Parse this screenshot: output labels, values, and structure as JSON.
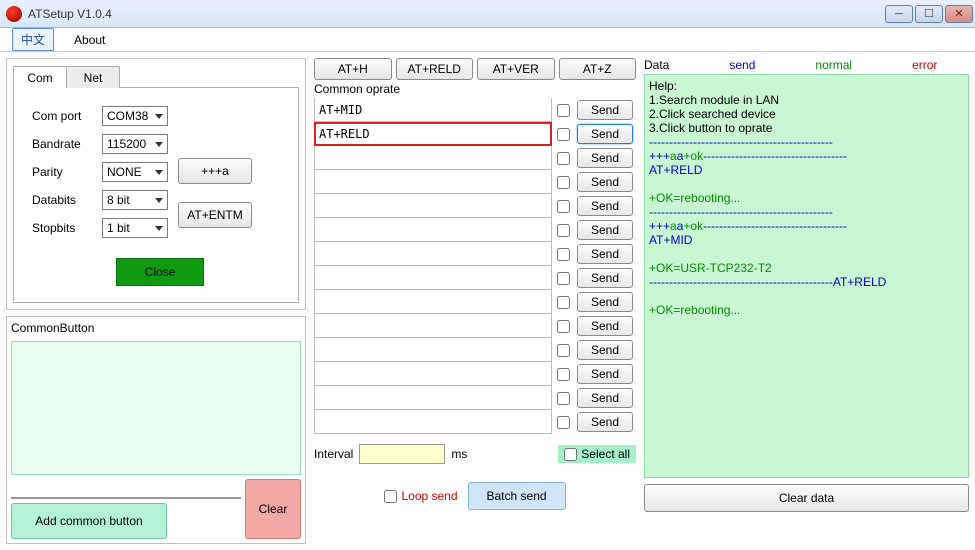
{
  "window": {
    "title": "ATSetup V1.0.4"
  },
  "menu": {
    "lang": "中文",
    "about": "About"
  },
  "tabs": {
    "com": "Com",
    "net": "Net"
  },
  "form": {
    "port_label": "Com port",
    "port_value": "COM38",
    "baud_label": "Bandrate",
    "baud_value": "115200",
    "parity_label": "Parity",
    "parity_value": "NONE",
    "databits_label": "Databits",
    "databits_value": "8 bit",
    "stopbits_label": "Stopbits",
    "stopbits_value": "1 bit",
    "plus_btn": "+++a",
    "entm_btn": "AT+ENTM",
    "close_btn": "Close"
  },
  "common_button": {
    "title": "CommonButton",
    "add": "Add common button",
    "clear": "Clear"
  },
  "top_at": [
    "AT+H",
    "AT+RELD",
    "AT+VER",
    "AT+Z"
  ],
  "section_label": "Common oprate",
  "cmds": [
    {
      "text": "AT+MID",
      "hl": false
    },
    {
      "text": "AT+RELD",
      "hl": true
    },
    {
      "text": "",
      "hl": false
    },
    {
      "text": "",
      "hl": false
    },
    {
      "text": "",
      "hl": false
    },
    {
      "text": "",
      "hl": false
    },
    {
      "text": "",
      "hl": false
    },
    {
      "text": "",
      "hl": false
    },
    {
      "text": "",
      "hl": false
    },
    {
      "text": "",
      "hl": false
    },
    {
      "text": "",
      "hl": false
    },
    {
      "text": "",
      "hl": false
    },
    {
      "text": "",
      "hl": false
    },
    {
      "text": "",
      "hl": false
    }
  ],
  "send_label": "Send",
  "interval": {
    "label": "Interval",
    "unit": "ms",
    "select_all": "Select all"
  },
  "bottom": {
    "loop": "Loop send",
    "batch": "Batch send"
  },
  "data_panel": {
    "title": "Data",
    "send": "send",
    "normal": "normal",
    "error": "error",
    "help1": "Help:",
    "help2": "1.Search module in LAN",
    "help3": "2.Click searched device",
    "help4": "3.Click button to oprate",
    "lines": [
      {
        "t": "d",
        "v": "----------------------------------------------"
      },
      {
        "t": "s",
        "v": "+++"
      },
      {
        "t": "n",
        "v": "a"
      },
      {
        "t": "s",
        "v": "a"
      },
      {
        "t": "n",
        "v": "+ok"
      },
      {
        "t": "d",
        "v": "------------------------------------"
      },
      {
        "t": "br"
      },
      {
        "t": "s",
        "v": "AT+RELD"
      },
      {
        "t": "br"
      },
      {
        "t": "br"
      },
      {
        "t": "n",
        "v": "+OK=rebooting..."
      },
      {
        "t": "br"
      },
      {
        "t": "d",
        "v": "----------------------------------------------"
      },
      {
        "t": "s",
        "v": "+++"
      },
      {
        "t": "n",
        "v": "a"
      },
      {
        "t": "s",
        "v": "a"
      },
      {
        "t": "n",
        "v": "+ok"
      },
      {
        "t": "d",
        "v": "------------------------------------"
      },
      {
        "t": "br"
      },
      {
        "t": "s",
        "v": "AT+MID"
      },
      {
        "t": "br"
      },
      {
        "t": "br"
      },
      {
        "t": "n",
        "v": "+OK=USR-TCP232-T2"
      },
      {
        "t": "br"
      },
      {
        "t": "d",
        "v": "----------------------------------------------"
      },
      {
        "t": "s",
        "v": "AT+RELD"
      },
      {
        "t": "br"
      },
      {
        "t": "br"
      },
      {
        "t": "n",
        "v": "+OK=rebooting..."
      }
    ],
    "clear": "Clear data"
  }
}
